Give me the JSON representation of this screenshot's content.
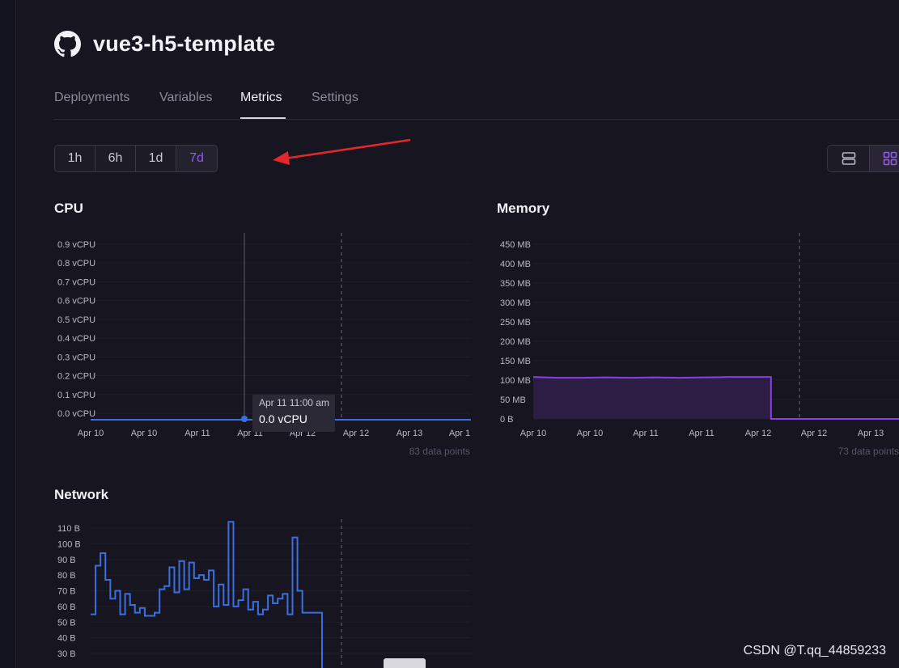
{
  "app": {
    "title": "vue3-h5-template"
  },
  "tabs": [
    {
      "label": "Deployments",
      "active": false
    },
    {
      "label": "Variables",
      "active": false
    },
    {
      "label": "Metrics",
      "active": true
    },
    {
      "label": "Settings",
      "active": false
    }
  ],
  "time_range": {
    "options": [
      "1h",
      "6h",
      "1d",
      "7d"
    ],
    "selected": "7d"
  },
  "view_toggle": {
    "options": [
      "list-view-icon",
      "grid-view-icon"
    ],
    "selected": "grid-view-icon"
  },
  "colors": {
    "accent": "#8f5ce8",
    "cpu_line": "#3b6fe0",
    "memory_line": "#8a3fe6",
    "memory_fill": "#2c1d44",
    "network_line": "#3b6fe0"
  },
  "chart_data": [
    {
      "type": "line",
      "title": "CPU",
      "y_ticks": [
        "0.0 vCPU",
        "0.1 vCPU",
        "0.2 vCPU",
        "0.3 vCPU",
        "0.4 vCPU",
        "0.5 vCPU",
        "0.6 vCPU",
        "0.7 vCPU",
        "0.8 vCPU",
        "0.9 vCPU"
      ],
      "ylim": [
        0,
        0.9
      ],
      "x_ticks": [
        "Apr 10",
        "Apr 10",
        "Apr 11",
        "Apr 11",
        "Apr 12",
        "Apr 12",
        "Apr 13",
        "Apr 1"
      ],
      "series": [
        {
          "values": [
            0.0,
            0.0,
            0.0,
            0.0,
            0.0,
            0.0,
            0.0,
            0.0,
            0.0,
            0.0
          ]
        }
      ],
      "tooltip": {
        "time": "Apr 11 11:00 am",
        "value": "0.0 vCPU"
      },
      "footnote": "83 data points"
    },
    {
      "type": "area",
      "title": "Memory",
      "y_ticks": [
        "0 B",
        "50 MB",
        "100 MB",
        "150 MB",
        "200 MB",
        "250 MB",
        "300 MB",
        "350 MB",
        "400 MB",
        "450 MB"
      ],
      "ylim": [
        0,
        450
      ],
      "x_ticks": [
        "Apr 10",
        "Apr 10",
        "Apr 11",
        "Apr 11",
        "Apr 12",
        "Apr 12",
        "Apr 13"
      ],
      "series": [
        {
          "x": [
            0,
            0.4,
            0.8,
            1.2,
            1.6,
            2.0,
            2.4,
            2.8,
            3.2,
            3.9,
            3.9,
            4.6,
            5.0,
            6.0
          ],
          "values": [
            108,
            106,
            106,
            107,
            106,
            107,
            106,
            107,
            108,
            108,
            0,
            0,
            0,
            0
          ]
        }
      ],
      "footnote": "73 data points"
    },
    {
      "type": "line",
      "title": "Network",
      "y_ticks": [
        "30 B",
        "40 B",
        "50 B",
        "60 B",
        "70 B",
        "80 B",
        "90 B",
        "100 B",
        "110 B"
      ],
      "ylim": [
        20,
        110
      ],
      "series": [
        {
          "values": [
            55,
            86,
            94,
            77,
            65,
            70,
            55,
            68,
            61,
            56,
            59,
            54,
            54,
            56,
            71,
            73,
            85,
            69,
            89,
            71,
            88,
            78,
            80,
            77,
            83,
            60,
            74,
            61,
            114,
            60,
            64,
            71,
            58,
            63,
            55,
            58,
            67,
            62,
            65,
            68,
            55,
            104,
            70,
            56,
            56,
            56,
            56,
            20
          ]
        }
      ]
    }
  ],
  "watermark": "CSDN @T.qq_44859233"
}
